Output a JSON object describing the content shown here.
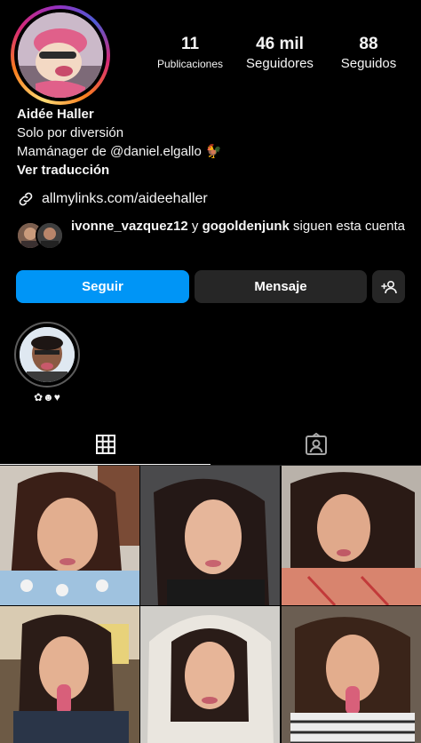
{
  "profile": {
    "stats": [
      {
        "value": "11",
        "label": "Publicaciones"
      },
      {
        "value": "46 mil",
        "label": "Seguidores"
      },
      {
        "value": "88",
        "label": "Seguidos"
      }
    ],
    "name": "Aidée Haller",
    "bio_line1": "Solo por diversión",
    "bio_line2": "Mamánager de @daniel.elgallo 🐓",
    "translate_label": "Ver traducción",
    "link": "allmylinks.com/aideehaller",
    "followed_by_user1": "ivonne_vazquez12",
    "followed_by_connector": " y ",
    "followed_by_user2": "gogoldenjunk",
    "followed_by_suffix": " siguen esta cuenta"
  },
  "actions": {
    "follow_label": "Seguir",
    "message_label": "Mensaje",
    "add_user_icon": "add-person-icon"
  },
  "highlights": [
    {
      "label": "✿☻♥"
    }
  ],
  "tabs": [
    {
      "icon": "grid-icon",
      "active": true
    },
    {
      "icon": "tagged-person-icon",
      "active": false
    }
  ],
  "colors": {
    "background": "#000000",
    "primary_button": "#0095f6",
    "secondary_button": "#262626",
    "text": "#f5f5f5"
  }
}
